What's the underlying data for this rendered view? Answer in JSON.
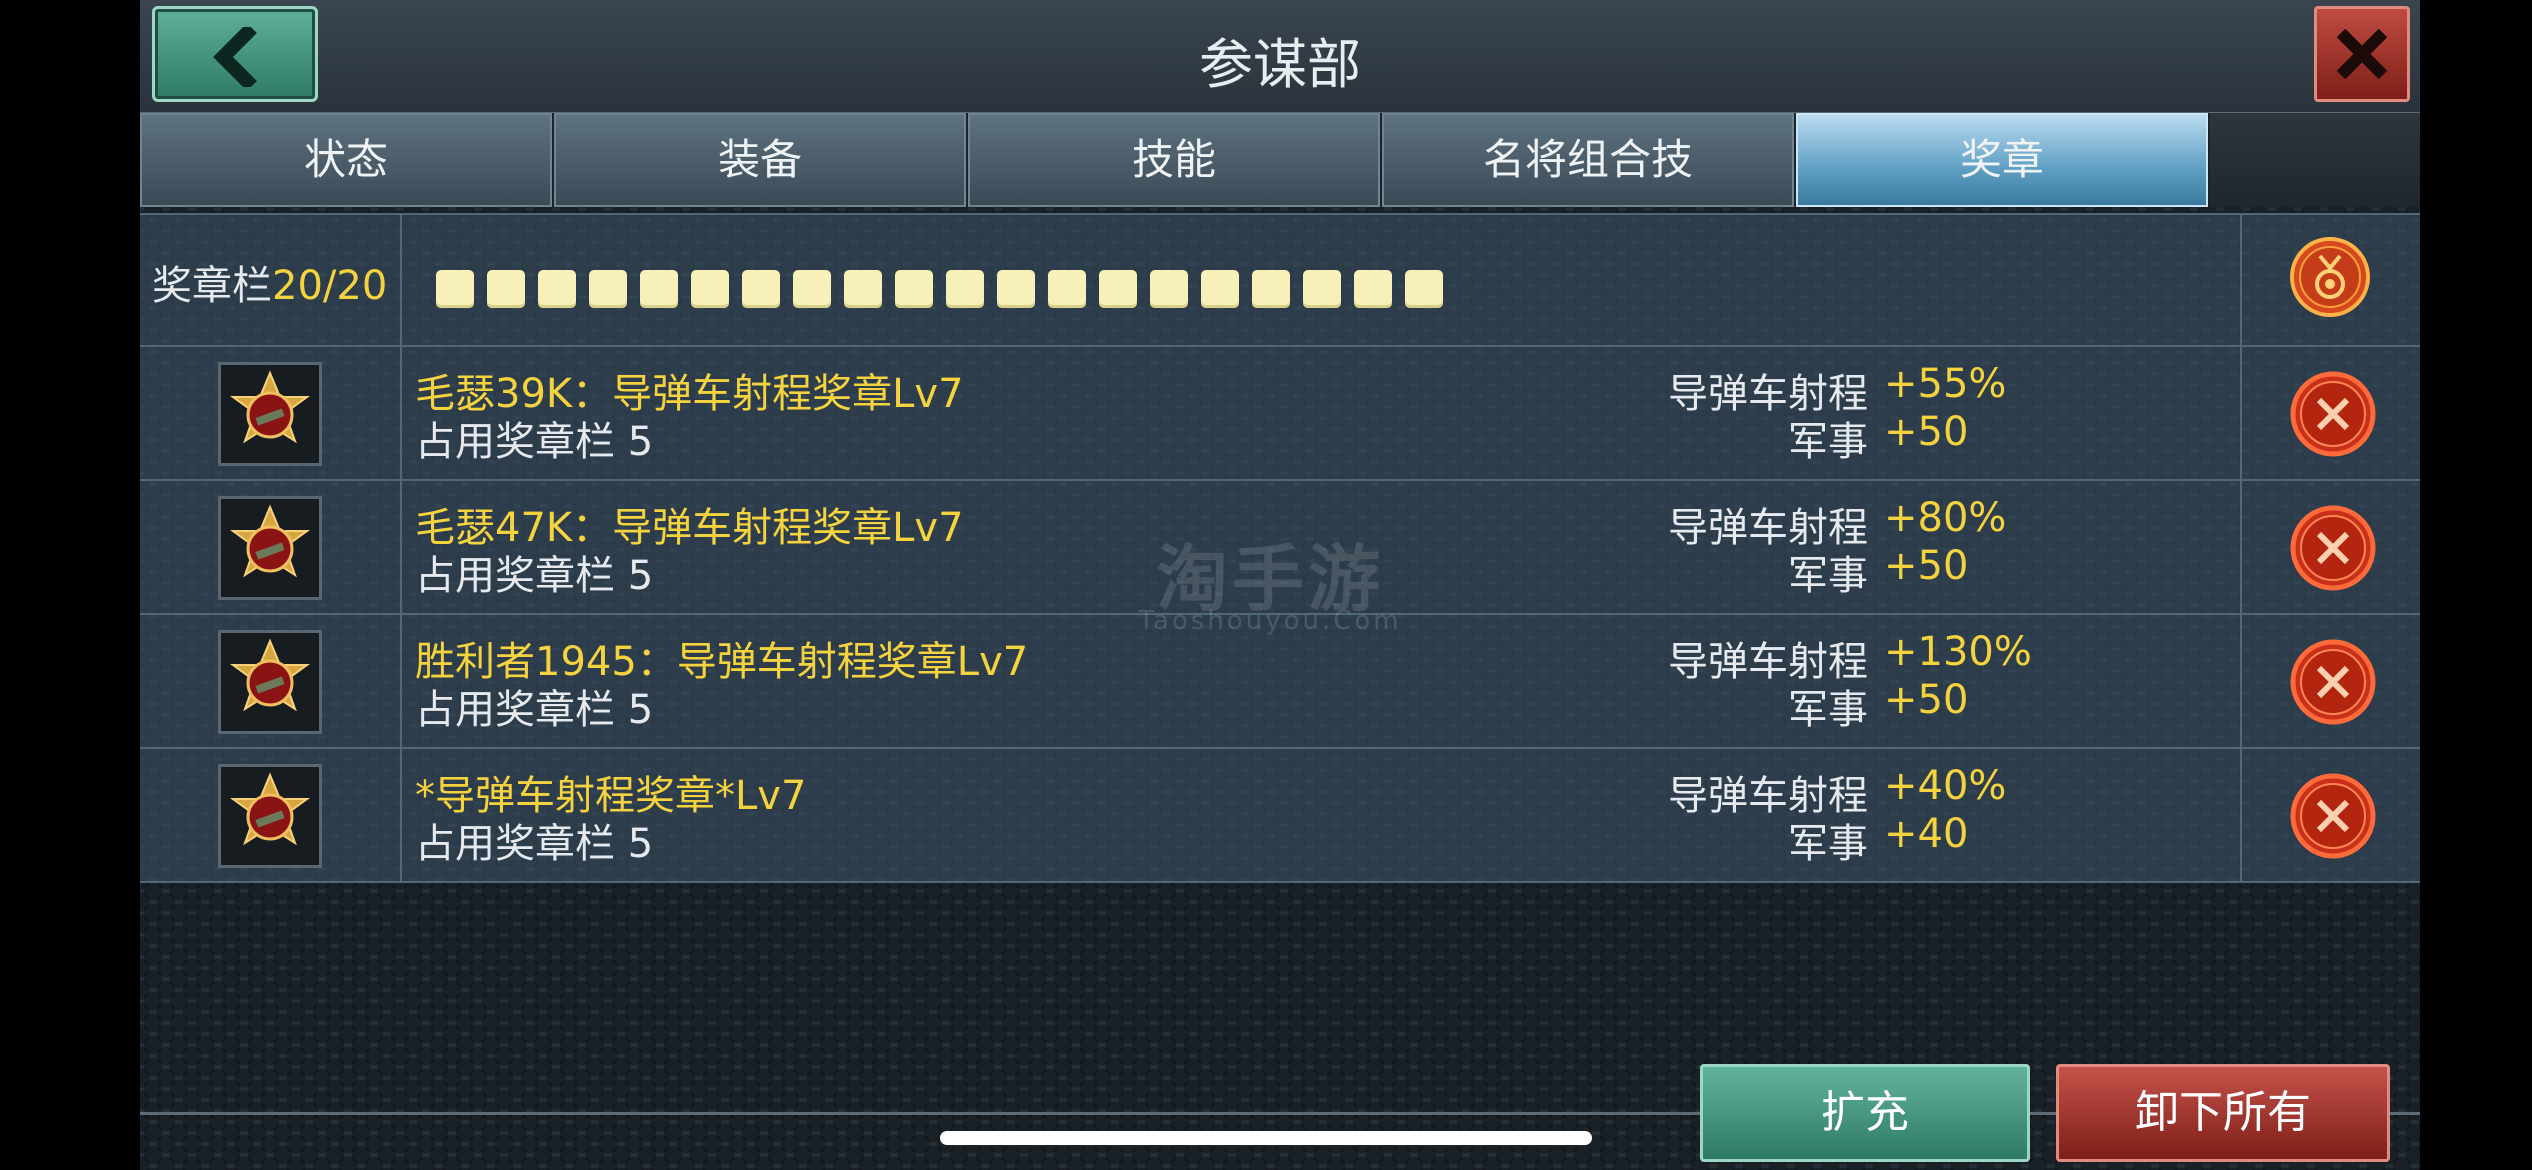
{
  "header": {
    "title": "参谋部"
  },
  "tabs": [
    {
      "label": "状态"
    },
    {
      "label": "装备"
    },
    {
      "label": "技能"
    },
    {
      "label": "名将组合技"
    },
    {
      "label": "奖章",
      "active": true
    }
  ],
  "slot_bar": {
    "label": "奖章栏",
    "count": "20/20",
    "slots_filled": 20,
    "slots_total": 20
  },
  "medals": [
    {
      "name": "毛瑟39K：导弹车射程奖章Lv7",
      "occupy_label": "占用奖章栏",
      "occupy_value": "5",
      "stat1_label": "导弹车射程",
      "stat1_value": "+55%",
      "stat2_label": "军事",
      "stat2_value": "+50"
    },
    {
      "name": "毛瑟47K：导弹车射程奖章Lv7",
      "occupy_label": "占用奖章栏",
      "occupy_value": "5",
      "stat1_label": "导弹车射程",
      "stat1_value": "+80%",
      "stat2_label": "军事",
      "stat2_value": "+50"
    },
    {
      "name": "胜利者1945：导弹车射程奖章Lv7",
      "occupy_label": "占用奖章栏",
      "occupy_value": "5",
      "stat1_label": "导弹车射程",
      "stat1_value": "+130%",
      "stat2_label": "军事",
      "stat2_value": "+50"
    },
    {
      "name": "*导弹车射程奖章*Lv7",
      "occupy_label": "占用奖章栏",
      "occupy_value": "5",
      "stat1_label": "导弹车射程",
      "stat1_value": "+40%",
      "stat2_label": "军事",
      "stat2_value": "+40"
    }
  ],
  "buttons": {
    "expand": "扩充",
    "unload_all": "卸下所有"
  },
  "watermark": {
    "main": "淘手游",
    "sub": "Taoshouyou.Com"
  },
  "colors": {
    "accent_yellow": "#f5d33e",
    "green_button": "#2e7a67",
    "red_button": "#7d1f18"
  },
  "icons": [
    "back-arrow-icon",
    "close-icon",
    "medal-icon",
    "remove-icon"
  ]
}
